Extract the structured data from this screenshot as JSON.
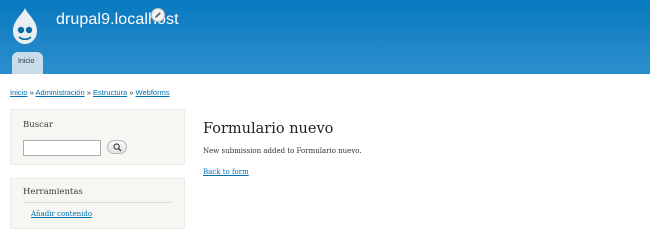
{
  "header": {
    "site_name": "drupal9.localhost",
    "logo_icon": "drupal-drop-icon",
    "edit_icon": "pencil-icon",
    "tabs": [
      {
        "label": "Inicio"
      }
    ],
    "colors": {
      "header_bg": "#0779bf",
      "tab_bg": "#c9dcec"
    }
  },
  "breadcrumb": {
    "items": [
      "Inicio",
      "Administración",
      "Estructura",
      "Webforms"
    ],
    "separator": "»"
  },
  "sidebar": {
    "search": {
      "title": "Buscar",
      "input_value": "",
      "button_icon": "search-icon"
    },
    "tools": {
      "title": "Herramientas",
      "links": [
        "Añadir contenido"
      ]
    }
  },
  "main": {
    "title": "Formulario nuevo",
    "status_message": "New submission added to Formulario nuevo.",
    "back_link": "Back to form"
  },
  "colors": {
    "link": "#0071b3",
    "sidebar_bg": "#f6f6f2"
  }
}
